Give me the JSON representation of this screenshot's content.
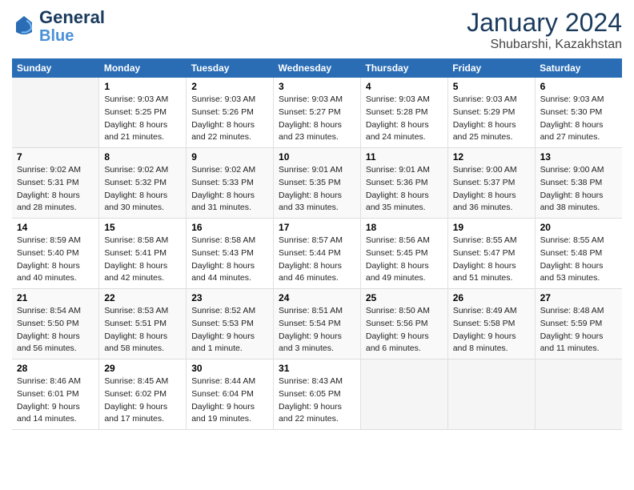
{
  "header": {
    "logo_line1": "General",
    "logo_line2": "Blue",
    "month": "January 2024",
    "location": "Shubarshi, Kazakhstan"
  },
  "columns": [
    "Sunday",
    "Monday",
    "Tuesday",
    "Wednesday",
    "Thursday",
    "Friday",
    "Saturday"
  ],
  "weeks": [
    [
      {
        "day": "",
        "sunrise": "",
        "sunset": "",
        "daylight": ""
      },
      {
        "day": "1",
        "sunrise": "Sunrise: 9:03 AM",
        "sunset": "Sunset: 5:25 PM",
        "daylight": "Daylight: 8 hours and 21 minutes."
      },
      {
        "day": "2",
        "sunrise": "Sunrise: 9:03 AM",
        "sunset": "Sunset: 5:26 PM",
        "daylight": "Daylight: 8 hours and 22 minutes."
      },
      {
        "day": "3",
        "sunrise": "Sunrise: 9:03 AM",
        "sunset": "Sunset: 5:27 PM",
        "daylight": "Daylight: 8 hours and 23 minutes."
      },
      {
        "day": "4",
        "sunrise": "Sunrise: 9:03 AM",
        "sunset": "Sunset: 5:28 PM",
        "daylight": "Daylight: 8 hours and 24 minutes."
      },
      {
        "day": "5",
        "sunrise": "Sunrise: 9:03 AM",
        "sunset": "Sunset: 5:29 PM",
        "daylight": "Daylight: 8 hours and 25 minutes."
      },
      {
        "day": "6",
        "sunrise": "Sunrise: 9:03 AM",
        "sunset": "Sunset: 5:30 PM",
        "daylight": "Daylight: 8 hours and 27 minutes."
      }
    ],
    [
      {
        "day": "7",
        "sunrise": "Sunrise: 9:02 AM",
        "sunset": "Sunset: 5:31 PM",
        "daylight": "Daylight: 8 hours and 28 minutes."
      },
      {
        "day": "8",
        "sunrise": "Sunrise: 9:02 AM",
        "sunset": "Sunset: 5:32 PM",
        "daylight": "Daylight: 8 hours and 30 minutes."
      },
      {
        "day": "9",
        "sunrise": "Sunrise: 9:02 AM",
        "sunset": "Sunset: 5:33 PM",
        "daylight": "Daylight: 8 hours and 31 minutes."
      },
      {
        "day": "10",
        "sunrise": "Sunrise: 9:01 AM",
        "sunset": "Sunset: 5:35 PM",
        "daylight": "Daylight: 8 hours and 33 minutes."
      },
      {
        "day": "11",
        "sunrise": "Sunrise: 9:01 AM",
        "sunset": "Sunset: 5:36 PM",
        "daylight": "Daylight: 8 hours and 35 minutes."
      },
      {
        "day": "12",
        "sunrise": "Sunrise: 9:00 AM",
        "sunset": "Sunset: 5:37 PM",
        "daylight": "Daylight: 8 hours and 36 minutes."
      },
      {
        "day": "13",
        "sunrise": "Sunrise: 9:00 AM",
        "sunset": "Sunset: 5:38 PM",
        "daylight": "Daylight: 8 hours and 38 minutes."
      }
    ],
    [
      {
        "day": "14",
        "sunrise": "Sunrise: 8:59 AM",
        "sunset": "Sunset: 5:40 PM",
        "daylight": "Daylight: 8 hours and 40 minutes."
      },
      {
        "day": "15",
        "sunrise": "Sunrise: 8:58 AM",
        "sunset": "Sunset: 5:41 PM",
        "daylight": "Daylight: 8 hours and 42 minutes."
      },
      {
        "day": "16",
        "sunrise": "Sunrise: 8:58 AM",
        "sunset": "Sunset: 5:43 PM",
        "daylight": "Daylight: 8 hours and 44 minutes."
      },
      {
        "day": "17",
        "sunrise": "Sunrise: 8:57 AM",
        "sunset": "Sunset: 5:44 PM",
        "daylight": "Daylight: 8 hours and 46 minutes."
      },
      {
        "day": "18",
        "sunrise": "Sunrise: 8:56 AM",
        "sunset": "Sunset: 5:45 PM",
        "daylight": "Daylight: 8 hours and 49 minutes."
      },
      {
        "day": "19",
        "sunrise": "Sunrise: 8:55 AM",
        "sunset": "Sunset: 5:47 PM",
        "daylight": "Daylight: 8 hours and 51 minutes."
      },
      {
        "day": "20",
        "sunrise": "Sunrise: 8:55 AM",
        "sunset": "Sunset: 5:48 PM",
        "daylight": "Daylight: 8 hours and 53 minutes."
      }
    ],
    [
      {
        "day": "21",
        "sunrise": "Sunrise: 8:54 AM",
        "sunset": "Sunset: 5:50 PM",
        "daylight": "Daylight: 8 hours and 56 minutes."
      },
      {
        "day": "22",
        "sunrise": "Sunrise: 8:53 AM",
        "sunset": "Sunset: 5:51 PM",
        "daylight": "Daylight: 8 hours and 58 minutes."
      },
      {
        "day": "23",
        "sunrise": "Sunrise: 8:52 AM",
        "sunset": "Sunset: 5:53 PM",
        "daylight": "Daylight: 9 hours and 1 minute."
      },
      {
        "day": "24",
        "sunrise": "Sunrise: 8:51 AM",
        "sunset": "Sunset: 5:54 PM",
        "daylight": "Daylight: 9 hours and 3 minutes."
      },
      {
        "day": "25",
        "sunrise": "Sunrise: 8:50 AM",
        "sunset": "Sunset: 5:56 PM",
        "daylight": "Daylight: 9 hours and 6 minutes."
      },
      {
        "day": "26",
        "sunrise": "Sunrise: 8:49 AM",
        "sunset": "Sunset: 5:58 PM",
        "daylight": "Daylight: 9 hours and 8 minutes."
      },
      {
        "day": "27",
        "sunrise": "Sunrise: 8:48 AM",
        "sunset": "Sunset: 5:59 PM",
        "daylight": "Daylight: 9 hours and 11 minutes."
      }
    ],
    [
      {
        "day": "28",
        "sunrise": "Sunrise: 8:46 AM",
        "sunset": "Sunset: 6:01 PM",
        "daylight": "Daylight: 9 hours and 14 minutes."
      },
      {
        "day": "29",
        "sunrise": "Sunrise: 8:45 AM",
        "sunset": "Sunset: 6:02 PM",
        "daylight": "Daylight: 9 hours and 17 minutes."
      },
      {
        "day": "30",
        "sunrise": "Sunrise: 8:44 AM",
        "sunset": "Sunset: 6:04 PM",
        "daylight": "Daylight: 9 hours and 19 minutes."
      },
      {
        "day": "31",
        "sunrise": "Sunrise: 8:43 AM",
        "sunset": "Sunset: 6:05 PM",
        "daylight": "Daylight: 9 hours and 22 minutes."
      },
      {
        "day": "",
        "sunrise": "",
        "sunset": "",
        "daylight": ""
      },
      {
        "day": "",
        "sunrise": "",
        "sunset": "",
        "daylight": ""
      },
      {
        "day": "",
        "sunrise": "",
        "sunset": "",
        "daylight": ""
      }
    ]
  ]
}
